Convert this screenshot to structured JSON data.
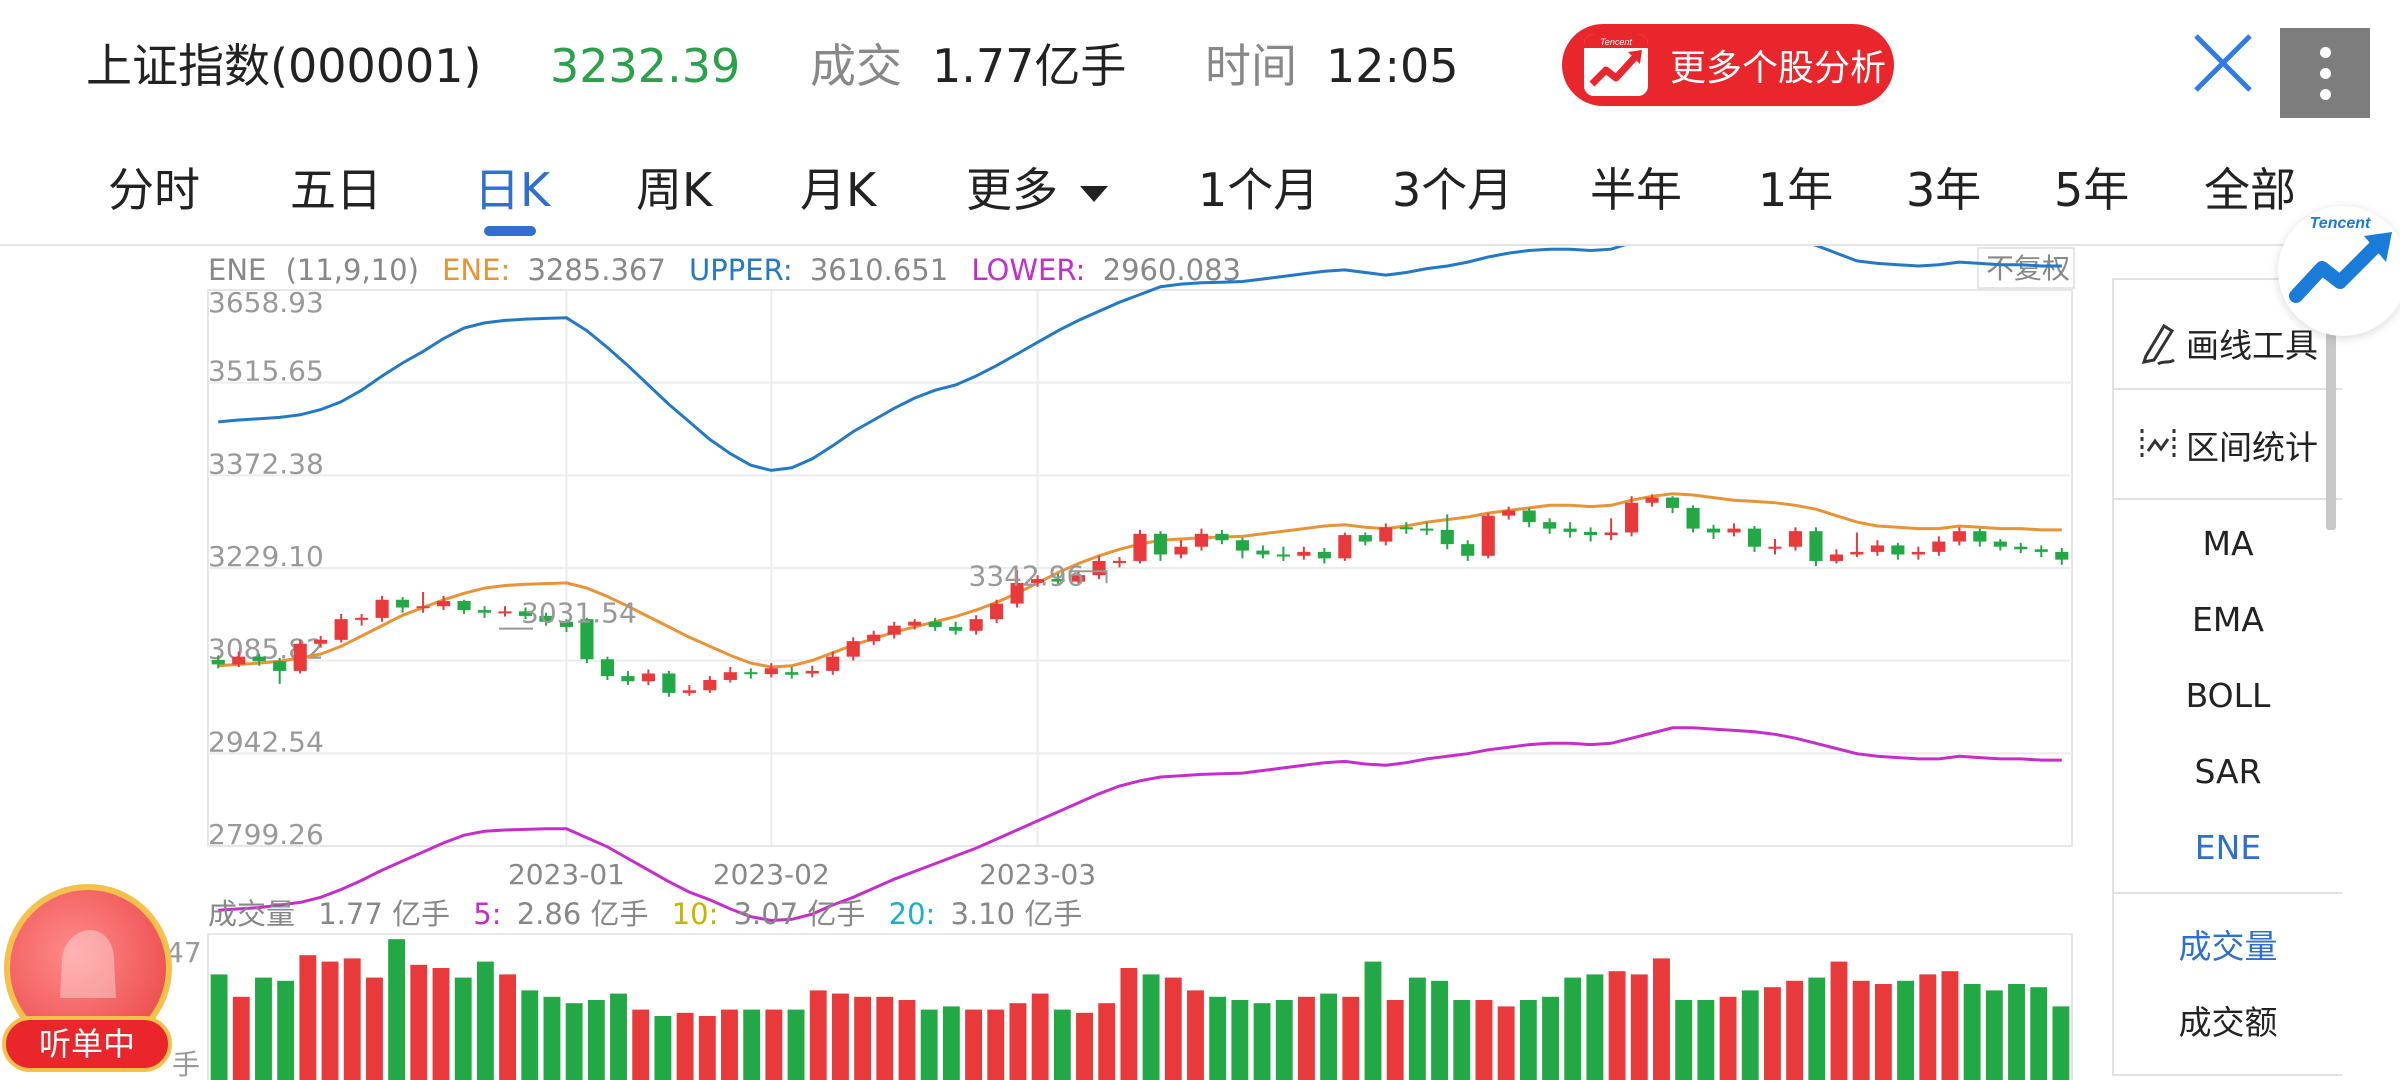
{
  "header": {
    "title": "上证指数(000001)",
    "price": "3232.39",
    "volume_label": "成交",
    "volume": "1.77亿手",
    "time_label": "时间",
    "time": "12:05",
    "promo_label": "更多个股分析"
  },
  "tabs": [
    {
      "label": "分时"
    },
    {
      "label": "五日"
    },
    {
      "label": "日K"
    },
    {
      "label": "周K"
    },
    {
      "label": "月K"
    },
    {
      "label": "更多"
    },
    {
      "label": "1个月"
    },
    {
      "label": "3个月"
    },
    {
      "label": "半年"
    },
    {
      "label": "1年"
    },
    {
      "label": "3年"
    },
    {
      "label": "5年"
    },
    {
      "label": "全部"
    }
  ],
  "active_tab": "日K",
  "indicator_legend": {
    "name": "ENE",
    "params": "(11,9,10)",
    "ene_label": "ENE:",
    "ene_value": "3285.367",
    "upper_label": "UPPER:",
    "upper_value": "3610.651",
    "lower_label": "LOWER:",
    "lower_value": "2960.083",
    "adjust": "不复权"
  },
  "volume_legend": {
    "label": "成交量",
    "value": "1.77 亿手",
    "ma5_label": "5:",
    "ma5_value": "2.86 亿手",
    "ma10_label": "10:",
    "ma10_value": "3.07 亿手",
    "ma20_label": "20:",
    "ma20_value": "3.10 亿手",
    "axis_top": "47",
    "axis_unit": "手"
  },
  "side_panel": {
    "tools": [
      {
        "label": "画线工具"
      },
      {
        "label": "区间统计"
      }
    ],
    "indicators": [
      {
        "label": "MA"
      },
      {
        "label": "EMA"
      },
      {
        "label": "BOLL"
      },
      {
        "label": "SAR"
      },
      {
        "label": "ENE"
      }
    ],
    "active_indicator": "ENE",
    "sub_indicators": [
      {
        "label": "成交量"
      },
      {
        "label": "成交额"
      }
    ],
    "active_sub": "成交量"
  },
  "listen_badge": "听单中",
  "colors": {
    "up": "#e8393b",
    "down": "#22a845",
    "ene": "#e89436",
    "upper": "#2379c6",
    "lower": "#c62ecc",
    "accent": "#2f6fd0",
    "price": "#2aa14a"
  },
  "chart_data": {
    "type": "candlestick",
    "ylabels": [
      "3658.93",
      "3515.65",
      "3372.38",
      "3229.10",
      "3085.82",
      "2942.54",
      "2799.26"
    ],
    "ylim": [
      2799.26,
      3658.93
    ],
    "xlabels": [
      "2023-01",
      "2023-02",
      "2023-03"
    ],
    "xlabel_index": [
      17,
      27,
      40
    ],
    "annotations": [
      {
        "text": "3031.54",
        "index": 14
      },
      {
        "text": "3342.96",
        "index": 42
      }
    ],
    "candles": [
      [
        3087,
        3080,
        3094,
        3074
      ],
      [
        3080,
        3092,
        3100,
        3076
      ],
      [
        3092,
        3085,
        3096,
        3078
      ],
      [
        3085,
        3070,
        3090,
        3050
      ],
      [
        3070,
        3112,
        3118,
        3066
      ],
      [
        3112,
        3118,
        3124,
        3106
      ],
      [
        3118,
        3150,
        3158,
        3114
      ],
      [
        3150,
        3152,
        3158,
        3140
      ],
      [
        3152,
        3180,
        3186,
        3146
      ],
      [
        3180,
        3168,
        3184,
        3160
      ],
      [
        3168,
        3170,
        3192,
        3160
      ],
      [
        3170,
        3178,
        3186,
        3164
      ],
      [
        3178,
        3164,
        3180,
        3158
      ],
      [
        3164,
        3160,
        3170,
        3152
      ],
      [
        3160,
        3162,
        3170,
        3154
      ],
      [
        3162,
        3155,
        3168,
        3150
      ],
      [
        3155,
        3146,
        3160,
        3140
      ],
      [
        3146,
        3138,
        3150,
        3130
      ],
      [
        3150,
        3088,
        3152,
        3082
      ],
      [
        3088,
        3062,
        3092,
        3056
      ],
      [
        3062,
        3054,
        3070,
        3048
      ],
      [
        3054,
        3066,
        3072,
        3048
      ],
      [
        3066,
        3036,
        3070,
        3030
      ],
      [
        3036,
        3040,
        3048,
        3031.54
      ],
      [
        3040,
        3056,
        3062,
        3036
      ],
      [
        3056,
        3068,
        3076,
        3052
      ],
      [
        3068,
        3065,
        3074,
        3058
      ],
      [
        3065,
        3074,
        3082,
        3060
      ],
      [
        3068,
        3064,
        3076,
        3058
      ],
      [
        3066,
        3070,
        3078,
        3060
      ],
      [
        3070,
        3092,
        3100,
        3064
      ],
      [
        3092,
        3116,
        3122,
        3086
      ],
      [
        3116,
        3126,
        3132,
        3110
      ],
      [
        3126,
        3140,
        3146,
        3120
      ],
      [
        3140,
        3146,
        3150,
        3134
      ],
      [
        3146,
        3138,
        3152,
        3132
      ],
      [
        3138,
        3132,
        3146,
        3126
      ],
      [
        3132,
        3150,
        3156,
        3126
      ],
      [
        3150,
        3174,
        3180,
        3144
      ],
      [
        3174,
        3206,
        3226,
        3168
      ],
      [
        3206,
        3212,
        3218,
        3200
      ],
      [
        3212,
        3208,
        3220,
        3202
      ],
      [
        3208,
        3218,
        3224,
        3202
      ],
      [
        3218,
        3240,
        3248,
        3212
      ],
      [
        3240,
        3240,
        3246,
        3230
      ],
      [
        3240,
        3282,
        3288,
        3236
      ],
      [
        3282,
        3250,
        3286,
        3240
      ],
      [
        3250,
        3262,
        3272,
        3244
      ],
      [
        3262,
        3282,
        3290,
        3256
      ],
      [
        3282,
        3272,
        3288,
        3266
      ],
      [
        3272,
        3256,
        3276,
        3244
      ],
      [
        3256,
        3250,
        3264,
        3244
      ],
      [
        3250,
        3248,
        3262,
        3240
      ],
      [
        3248,
        3254,
        3262,
        3242
      ],
      [
        3254,
        3244,
        3260,
        3236
      ],
      [
        3244,
        3280,
        3284,
        3240
      ],
      [
        3280,
        3270,
        3284,
        3264
      ],
      [
        3270,
        3292,
        3298,
        3264
      ],
      [
        3292,
        3290,
        3300,
        3282
      ],
      [
        3290,
        3288,
        3300,
        3280
      ],
      [
        3288,
        3266,
        3312,
        3258
      ],
      [
        3266,
        3248,
        3272,
        3240
      ],
      [
        3248,
        3310,
        3314,
        3244
      ],
      [
        3310,
        3318,
        3324,
        3304
      ],
      [
        3318,
        3300,
        3322,
        3292
      ],
      [
        3300,
        3290,
        3306,
        3282
      ],
      [
        3290,
        3285,
        3300,
        3276
      ],
      [
        3285,
        3280,
        3292,
        3270
      ],
      [
        3280,
        3284,
        3306,
        3272
      ],
      [
        3284,
        3330,
        3340,
        3278
      ],
      [
        3330,
        3338,
        3342.96,
        3324
      ],
      [
        3338,
        3322,
        3340,
        3314
      ],
      [
        3322,
        3290,
        3326,
        3284
      ],
      [
        3290,
        3284,
        3296,
        3274
      ],
      [
        3284,
        3290,
        3298,
        3278
      ],
      [
        3290,
        3262,
        3294,
        3254
      ],
      [
        3262,
        3262,
        3274,
        3250
      ],
      [
        3262,
        3286,
        3292,
        3256
      ],
      [
        3286,
        3240,
        3292,
        3232
      ],
      [
        3240,
        3250,
        3258,
        3236
      ],
      [
        3250,
        3254,
        3284,
        3246
      ],
      [
        3254,
        3264,
        3272,
        3248
      ],
      [
        3264,
        3250,
        3268,
        3242
      ],
      [
        3250,
        3254,
        3262,
        3242
      ],
      [
        3254,
        3270,
        3278,
        3248
      ],
      [
        3270,
        3286,
        3292,
        3264
      ],
      [
        3286,
        3270,
        3290,
        3262
      ],
      [
        3270,
        3262,
        3274,
        3256
      ],
      [
        3262,
        3258,
        3268,
        3252
      ],
      [
        3258,
        3254,
        3264,
        3246
      ],
      [
        3254,
        3242,
        3260,
        3234
      ]
    ],
    "ene": [
      3078,
      3080,
      3082,
      3085,
      3090,
      3096,
      3108,
      3124,
      3140,
      3156,
      3168,
      3180,
      3190,
      3198,
      3202,
      3204,
      3205,
      3206,
      3198,
      3185,
      3170,
      3154,
      3138,
      3122,
      3108,
      3094,
      3082,
      3076,
      3078,
      3086,
      3098,
      3110,
      3120,
      3130,
      3138,
      3146,
      3154,
      3164,
      3176,
      3190,
      3206,
      3222,
      3236,
      3248,
      3258,
      3266,
      3272,
      3274,
      3276,
      3277,
      3278,
      3282,
      3286,
      3290,
      3294,
      3296,
      3292,
      3290,
      3294,
      3300,
      3304,
      3308,
      3314,
      3318,
      3322,
      3326,
      3326,
      3324,
      3326,
      3334,
      3340,
      3344,
      3342,
      3338,
      3334,
      3332,
      3330,
      3326,
      3320,
      3310,
      3300,
      3294,
      3292,
      3290,
      3290,
      3294,
      3292,
      3290,
      3290,
      3288,
      3288
    ],
    "upper": [
      3455,
      3458,
      3460,
      3462,
      3466,
      3474,
      3486,
      3504,
      3526,
      3546,
      3564,
      3584,
      3600,
      3608,
      3612,
      3614,
      3615,
      3616,
      3596,
      3570,
      3542,
      3512,
      3482,
      3455,
      3428,
      3406,
      3388,
      3380,
      3384,
      3398,
      3418,
      3440,
      3458,
      3476,
      3492,
      3504,
      3512,
      3526,
      3542,
      3560,
      3578,
      3596,
      3612,
      3626,
      3640,
      3652,
      3664,
      3668,
      3670,
      3671,
      3672,
      3676,
      3680,
      3684,
      3688,
      3690,
      3686,
      3682,
      3686,
      3692,
      3696,
      3702,
      3710,
      3716,
      3720,
      3722,
      3722,
      3720,
      3722,
      3732,
      3742,
      3752,
      3752,
      3750,
      3748,
      3746,
      3742,
      3736,
      3728,
      3716,
      3704,
      3700,
      3698,
      3696,
      3698,
      3702,
      3700,
      3698,
      3698,
      3696,
      3696
    ],
    "lower": [
      2700,
      2702,
      2704,
      2708,
      2712,
      2720,
      2732,
      2746,
      2762,
      2776,
      2790,
      2804,
      2816,
      2822,
      2824,
      2825,
      2826,
      2826,
      2812,
      2798,
      2780,
      2762,
      2744,
      2728,
      2716,
      2702,
      2690,
      2684,
      2686,
      2694,
      2708,
      2720,
      2734,
      2748,
      2760,
      2772,
      2784,
      2796,
      2810,
      2824,
      2838,
      2852,
      2866,
      2880,
      2892,
      2900,
      2906,
      2908,
      2910,
      2911,
      2912,
      2916,
      2920,
      2924,
      2928,
      2930,
      2926,
      2924,
      2928,
      2934,
      2938,
      2942,
      2948,
      2952,
      2956,
      2958,
      2958,
      2956,
      2958,
      2966,
      2974,
      2982,
      2982,
      2980,
      2978,
      2976,
      2972,
      2966,
      2958,
      2950,
      2942,
      2938,
      2936,
      2934,
      2934,
      2938,
      2936,
      2934,
      2934,
      2932,
      2932
    ],
    "volumes": [
      3.3,
      2.6,
      3.2,
      3.1,
      3.9,
      3.7,
      3.8,
      3.2,
      4.4,
      3.6,
      3.5,
      3.2,
      3.7,
      3.3,
      2.8,
      2.6,
      2.4,
      2.5,
      2.7,
      2.2,
      2.0,
      2.1,
      2.0,
      2.2,
      2.2,
      2.2,
      2.2,
      2.8,
      2.7,
      2.6,
      2.6,
      2.5,
      2.2,
      2.3,
      2.2,
      2.2,
      2.4,
      2.7,
      2.2,
      2.1,
      2.4,
      3.5,
      3.3,
      3.2,
      2.8,
      2.6,
      2.5,
      2.4,
      2.5,
      2.6,
      2.7,
      2.6,
      3.7,
      2.5,
      3.2,
      3.1,
      2.5,
      2.5,
      2.3,
      2.5,
      2.6,
      3.2,
      3.3,
      3.4,
      3.3,
      3.8,
      2.5,
      2.5,
      2.6,
      2.8,
      2.9,
      3.1,
      3.2,
      3.7,
      3.1,
      3.0,
      3.1,
      3.3,
      3.4,
      3.0,
      2.8,
      3.0,
      2.9,
      2.3
    ]
  }
}
